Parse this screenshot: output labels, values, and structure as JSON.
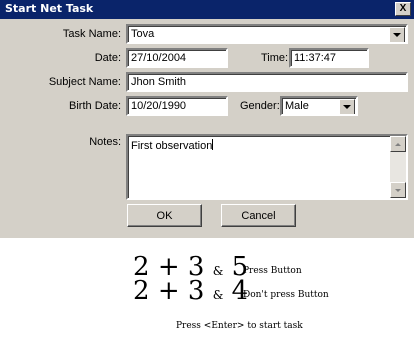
{
  "dialog": {
    "title": "Start Net Task",
    "close_label": "X",
    "task_name": {
      "label": "Task Name:",
      "value": "Tova"
    },
    "date": {
      "label": "Date:",
      "value": "27/10/2004"
    },
    "time": {
      "label": "Time:",
      "value": "11:37:47"
    },
    "subject_name": {
      "label": "Subject Name:",
      "value": "Jhon Smith"
    },
    "birth_date": {
      "label": "Birth Date:",
      "value": "10/20/1990"
    },
    "gender": {
      "label": "Gender:",
      "value": "Male"
    },
    "notes": {
      "label": "Notes:",
      "value": "First observation"
    },
    "ok_label": "OK",
    "cancel_label": "Cancel"
  },
  "task_screen": {
    "rows": [
      {
        "a": "2",
        "op": "+",
        "b": "3",
        "amp": "&",
        "c": "5",
        "caption": "Press Button"
      },
      {
        "a": "2",
        "op": "+",
        "b": "3",
        "amp": "&",
        "c": "4",
        "caption": "Don't press Button"
      }
    ],
    "instruction": "Press <Enter> to start task"
  },
  "colors": {
    "titlebar": "#0a246a",
    "dialog_bg": "#d4d0c8"
  }
}
